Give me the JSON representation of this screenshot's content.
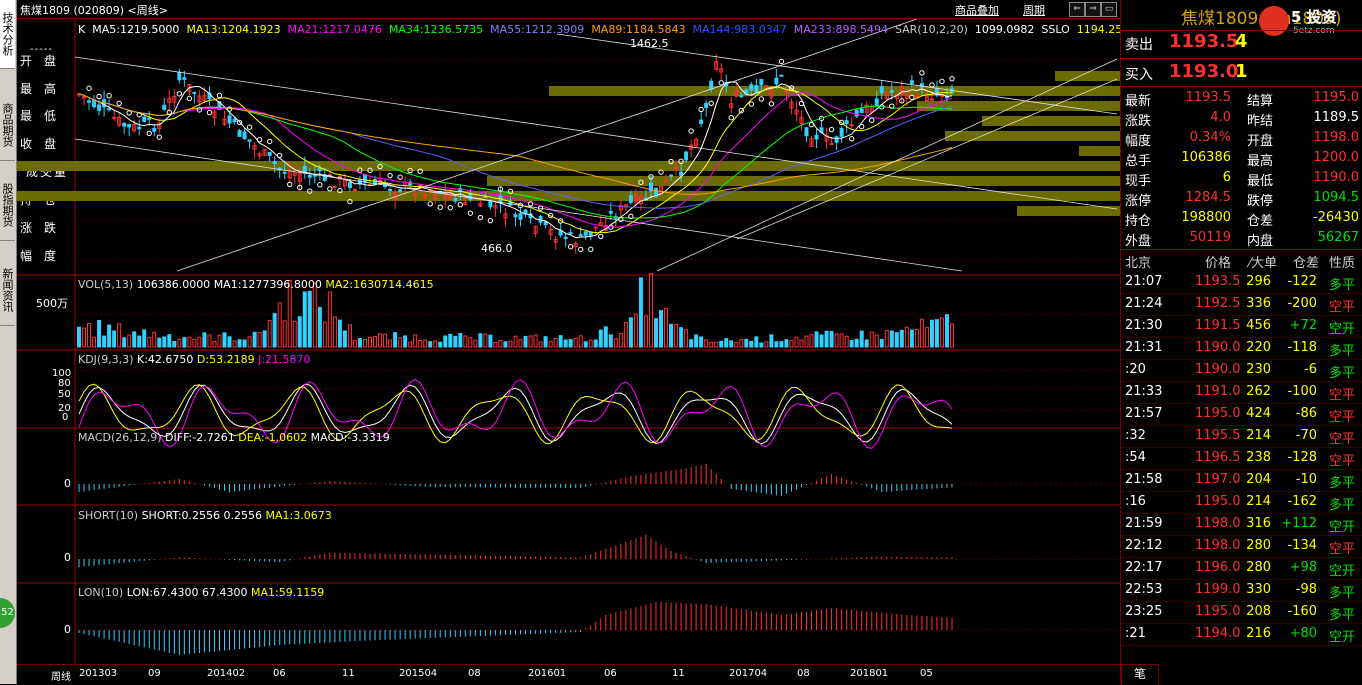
{
  "window": {
    "title": "焦煤1809 (020809) <周线>",
    "buttons": [
      "商品叠加",
      "周期"
    ],
    "nav": [
      "⇐",
      "⇒",
      "▭",
      "⊠"
    ]
  },
  "left_tabs": [
    "技术分析",
    "商品期货",
    "股指期货",
    "新闻资讯"
  ],
  "left_badge": "52",
  "info_panel": {
    "dash": "-----",
    "items": [
      "开盘",
      "最高",
      "最低",
      "收盘",
      "成交量",
      "持仓",
      "涨跌",
      "幅度"
    ]
  },
  "main_chart": {
    "header": {
      "k": "K",
      "ma5": "MA5:1219.5000",
      "ma13": "MA13:1204.1923",
      "ma21": "MA21:1217.0476",
      "ma34": "MA34:1236.5735",
      "ma55": "MA55:1212.3909",
      "ma89": "MA89:1184.5843",
      "ma144": "MA144:983.0347",
      "ma233": "MA233:898.5494",
      "sar": "SAR(10,2,20)",
      "sar_val": "1099.0982",
      "sslo": "SSLO",
      "sslo_val": "1194.250"
    },
    "high_label": "1462.5",
    "low_label": "466.0",
    "colors": {
      "ma5": "#ffffff",
      "ma13": "#ffff00",
      "ma21": "#ff00ff",
      "ma34": "#00ff00",
      "ma55": "#6060ff",
      "ma89": "#ffa000",
      "ma144": "#3050ff",
      "ma233": "#9040ff"
    }
  },
  "vol_panel": {
    "header": "VOL(5,13)",
    "vol": "106386.0000",
    "ma1": "MA1:1277396.8000",
    "ma2": "MA2:1630714.4615",
    "axis": "500万"
  },
  "kdj_panel": {
    "header": "KDJ(9,3,3)",
    "k": "K:42.6750",
    "d": "D:53.2189",
    "j": "J:21.5870",
    "ticks": [
      "100",
      "80",
      "50",
      "20",
      "0"
    ]
  },
  "macd_panel": {
    "header": "MACD(26,12,9)",
    "diff": "DIFF:-2.7261",
    "dea": "DEA:-1.0602",
    "macd": "MACD:-3.3319",
    "zero": "0"
  },
  "short_panel": {
    "header": "SHORT(10)",
    "val": "SHORT:0.2556",
    "val2": "0.2556",
    "ma1": "MA1:3.0673",
    "zero": "0"
  },
  "lon_panel": {
    "header": "LON(10)",
    "val": "LON:67.4300",
    "val2": "67.4300",
    "ma1": "MA1:59.1159",
    "zero": "0"
  },
  "x_axis": {
    "label": "周线",
    "ticks": [
      "201303",
      "09",
      "201402",
      "06",
      "11",
      "201504",
      "08",
      "201601",
      "06",
      "11",
      "201704",
      "08",
      "201801",
      "05"
    ]
  },
  "quote": {
    "title": "焦煤1809 (jm1809)",
    "logo_text": "5 投资",
    "logo_url": "5etz.com",
    "sell_label": "卖出",
    "sell_price": "1193.5",
    "sell_vol": "4",
    "buy_label": "买入",
    "buy_price": "1193.0",
    "buy_vol": "1",
    "rows": [
      {
        "l1": "最新",
        "v1": "1193.5",
        "c1": "red",
        "l2": "结算",
        "v2": "1195.0",
        "c2": "red"
      },
      {
        "l1": "涨跌",
        "v1": "4.0",
        "c1": "red",
        "l2": "昨结",
        "v2": "1189.5",
        "c2": "white"
      },
      {
        "l1": "幅度",
        "v1": "0.34%",
        "c1": "red",
        "l2": "开盘",
        "v2": "1198.0",
        "c2": "red"
      },
      {
        "l1": "总手",
        "v1": "106386",
        "c1": "yellow",
        "l2": "最高",
        "v2": "1200.0",
        "c2": "red"
      },
      {
        "l1": "现手",
        "v1": "6",
        "c1": "yellow",
        "l2": "最低",
        "v2": "1190.0",
        "c2": "red"
      },
      {
        "l1": "涨停",
        "v1": "1284.5",
        "c1": "red",
        "l2": "跌停",
        "v2": "1094.5",
        "c2": "green"
      },
      {
        "l1": "持仓",
        "v1": "198800",
        "c1": "yellow",
        "l2": "仓差",
        "v2": "-26430",
        "c2": "yellow"
      },
      {
        "l1": "外盘",
        "v1": "50119",
        "c1": "red",
        "l2": "内盘",
        "v2": "56267",
        "c2": "green"
      }
    ],
    "ticks_header": [
      "北京",
      "价格",
      "⁄大单",
      "仓差",
      "性质"
    ],
    "ticks": [
      {
        "t": "21:07",
        "p": "1193.5",
        "pc": "red",
        "v": "296",
        "d": "-122",
        "n": "多平",
        "nc": "green"
      },
      {
        "t": "21:24",
        "p": "1192.5",
        "pc": "red",
        "v": "336",
        "d": "-200",
        "n": "空平",
        "nc": "red"
      },
      {
        "t": "21:30",
        "p": "1191.5",
        "pc": "red",
        "v": "456",
        "d": "+72",
        "n": "空开",
        "nc": "green"
      },
      {
        "t": "21:31",
        "p": "1190.0",
        "pc": "red",
        "v": "220",
        "d": "-118",
        "n": "多平",
        "nc": "green"
      },
      {
        "t": ":20",
        "p": "1190.0",
        "pc": "red",
        "v": "230",
        "d": "-6",
        "n": "多平",
        "nc": "green"
      },
      {
        "t": "21:33",
        "p": "1191.0",
        "pc": "red",
        "v": "262",
        "d": "-100",
        "n": "空平",
        "nc": "red"
      },
      {
        "t": "21:57",
        "p": "1195.0",
        "pc": "red",
        "v": "424",
        "d": "-86",
        "n": "空平",
        "nc": "red"
      },
      {
        "t": ":32",
        "p": "1195.5",
        "pc": "red",
        "v": "214",
        "d": "-70",
        "n": "空平",
        "nc": "red"
      },
      {
        "t": ":54",
        "p": "1196.5",
        "pc": "red",
        "v": "238",
        "d": "-128",
        "n": "空平",
        "nc": "red"
      },
      {
        "t": "21:58",
        "p": "1197.0",
        "pc": "red",
        "v": "204",
        "d": "-10",
        "n": "多平",
        "nc": "green"
      },
      {
        "t": ":16",
        "p": "1195.0",
        "pc": "red",
        "v": "214",
        "d": "-162",
        "n": "多平",
        "nc": "green"
      },
      {
        "t": "21:59",
        "p": "1198.0",
        "pc": "red",
        "v": "316",
        "d": "+112",
        "n": "空开",
        "nc": "green"
      },
      {
        "t": "22:12",
        "p": "1198.0",
        "pc": "red",
        "v": "280",
        "d": "-134",
        "n": "空平",
        "nc": "red"
      },
      {
        "t": "22:17",
        "p": "1196.0",
        "pc": "red",
        "v": "280",
        "d": "+98",
        "n": "空开",
        "nc": "green"
      },
      {
        "t": "22:53",
        "p": "1199.0",
        "pc": "red",
        "v": "330",
        "d": "-98",
        "n": "多平",
        "nc": "green"
      },
      {
        "t": "23:25",
        "p": "1195.0",
        "pc": "red",
        "v": "208",
        "d": "-160",
        "n": "多平",
        "nc": "green"
      },
      {
        "t": ":21",
        "p": "1194.0",
        "pc": "red",
        "v": "216",
        "d": "+80",
        "n": "空开",
        "nc": "green"
      }
    ],
    "bottom_tab": "笔"
  }
}
